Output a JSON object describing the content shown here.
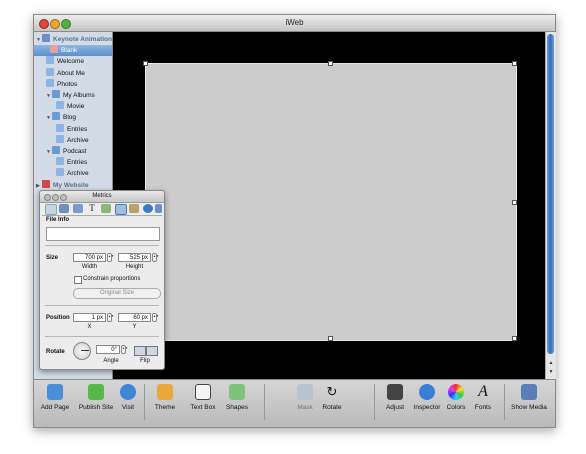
{
  "window": {
    "title": "iWeb"
  },
  "sidebar": {
    "items": [
      {
        "label": "Keynote Animation",
        "kind": "section",
        "indent": 0,
        "icon": "site-icon",
        "color": "#6b8fc4"
      },
      {
        "label": "Blank",
        "kind": "selected",
        "indent": 1,
        "icon": "page-icon",
        "color": "#e7a0a0"
      },
      {
        "label": "Welcome",
        "kind": "normal",
        "indent": 1,
        "icon": "page-icon",
        "color": "#8fb4e3"
      },
      {
        "label": "About Me",
        "kind": "normal",
        "indent": 1,
        "icon": "page-icon",
        "color": "#8fb4e3"
      },
      {
        "label": "Photos",
        "kind": "normal",
        "indent": 1,
        "icon": "page-icon",
        "color": "#8fb4e3"
      },
      {
        "label": "My Albums",
        "kind": "normal",
        "indent": 1,
        "icon": "album-icon",
        "color": "#6a9ad3"
      },
      {
        "label": "Movie",
        "kind": "normal",
        "indent": 2,
        "icon": "page-icon",
        "color": "#8fb4e3"
      },
      {
        "label": "Blog",
        "kind": "normal",
        "indent": 1,
        "icon": "blog-icon",
        "color": "#6a9ad3"
      },
      {
        "label": "Entries",
        "kind": "normal",
        "indent": 2,
        "icon": "page-icon",
        "color": "#8fb4e3"
      },
      {
        "label": "Archive",
        "kind": "normal",
        "indent": 2,
        "icon": "page-icon",
        "color": "#8fb4e3"
      },
      {
        "label": "Podcast",
        "kind": "normal",
        "indent": 1,
        "icon": "podcast-icon",
        "color": "#6a9ad3"
      },
      {
        "label": "Entries",
        "kind": "normal",
        "indent": 2,
        "icon": "page-icon",
        "color": "#8fb4e3"
      },
      {
        "label": "Archive",
        "kind": "normal",
        "indent": 2,
        "icon": "page-icon",
        "color": "#8fb4e3"
      },
      {
        "label": "My Website",
        "kind": "section",
        "indent": 0,
        "icon": "site-icon",
        "color": "#d04848"
      }
    ]
  },
  "toolbar": {
    "buttons": [
      {
        "label": "Add Page",
        "icon": "add-page-icon",
        "color": "#4c8ed8",
        "disabled": false
      },
      {
        "label": "Publish Site",
        "icon": "publish-icon",
        "color": "#58b84a",
        "disabled": false
      },
      {
        "label": "Visit",
        "icon": "visit-icon",
        "color": "#3f86d6",
        "disabled": false
      },
      {
        "label": "Theme",
        "icon": "theme-icon",
        "color": "#e8a93a",
        "disabled": false
      },
      {
        "label": "Text Box",
        "icon": "text-box-icon",
        "color": "#f4f4f4",
        "disabled": false
      },
      {
        "label": "Shapes",
        "icon": "shapes-icon",
        "color": "#7fc27a",
        "disabled": false
      },
      {
        "label": "Mask",
        "icon": "mask-icon",
        "color": "#b7c3d0",
        "disabled": true
      },
      {
        "label": "Rotate",
        "icon": "rotate-icon",
        "color": "#333333",
        "disabled": false
      },
      {
        "label": "Adjust",
        "icon": "adjust-icon",
        "color": "#444444",
        "disabled": false
      },
      {
        "label": "Inspector",
        "icon": "inspector-icon",
        "color": "#3b7fd4",
        "disabled": false
      },
      {
        "label": "Colors",
        "icon": "colors-icon",
        "color": "#e35b5b",
        "disabled": false
      },
      {
        "label": "Fonts",
        "icon": "fonts-icon",
        "color": "#222222",
        "disabled": false
      },
      {
        "label": "Show Media",
        "icon": "media-icon",
        "color": "#5a7fb8",
        "disabled": false
      }
    ]
  },
  "metrics": {
    "title": "Metrics",
    "file_info_label": "File Info",
    "size_label": "Size",
    "width_value": "700 px",
    "width_label": "Width",
    "height_value": "525 px",
    "height_label": "Height",
    "constrain_label": "Constrain proportions",
    "original_size_label": "Original Size",
    "position_label": "Position",
    "x_value": "1 px",
    "x_label": "X",
    "y_value": "60 px",
    "y_label": "Y",
    "rotate_label": "Rotate",
    "angle_value": "0°",
    "angle_label": "Angle",
    "flip_label": "Flip"
  }
}
